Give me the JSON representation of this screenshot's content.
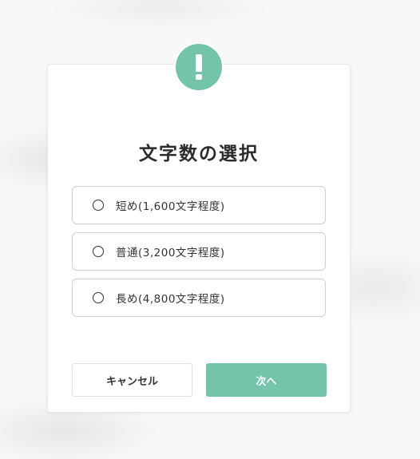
{
  "dialog": {
    "title": "文字数の選択",
    "badge_icon": "exclamation-icon",
    "accent_color": "#73c4ab",
    "options": [
      {
        "label": "短め(1,600文字程度)",
        "selected": false
      },
      {
        "label": "普通(3,200文字程度)",
        "selected": false
      },
      {
        "label": "長め(4,800文字程度)",
        "selected": false
      }
    ],
    "cancel_label": "キャンセル",
    "next_label": "次へ"
  }
}
